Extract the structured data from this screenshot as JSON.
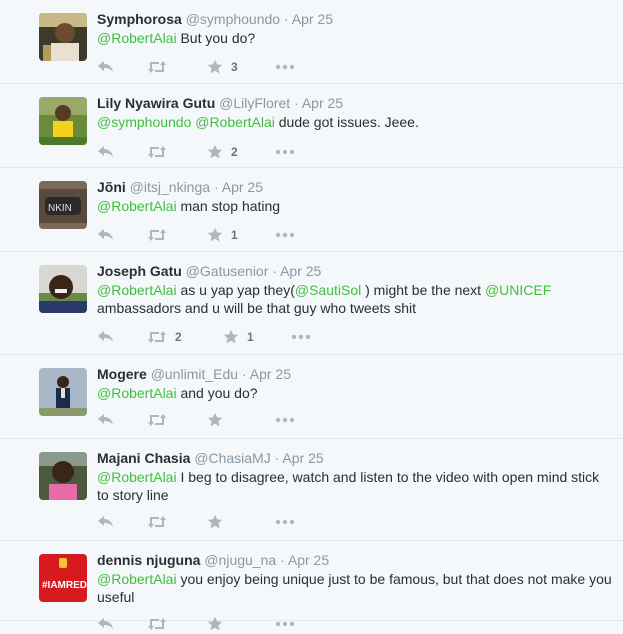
{
  "tweets": [
    {
      "name": "Symphorosa",
      "handle": "@symphoundo",
      "sep": "·",
      "time": "Apr 25",
      "text_parts": [
        {
          "t": "@RobertAlai",
          "mention": true
        },
        {
          "t": " But you do?"
        }
      ],
      "retweets": "",
      "favorites": "3"
    },
    {
      "name": "Lily Nyawira Gutu",
      "handle": "@LilyFloret",
      "sep": "·",
      "time": "Apr 25",
      "text_parts": [
        {
          "t": "@symphoundo",
          "mention": true
        },
        {
          "t": " "
        },
        {
          "t": "@RobertAlai",
          "mention": true
        },
        {
          "t": " dude got issues. Jeee."
        }
      ],
      "retweets": "",
      "favorites": "2"
    },
    {
      "name": "Jõni",
      "handle": "@itsj_nkinga",
      "sep": "·",
      "time": "Apr 25",
      "text_parts": [
        {
          "t": "@RobertAlai",
          "mention": true
        },
        {
          "t": " man stop hating"
        }
      ],
      "retweets": "",
      "favorites": "1"
    },
    {
      "name": "Joseph Gatu",
      "handle": "@Gatusenior",
      "sep": "·",
      "time": "Apr 25",
      "text_parts": [
        {
          "t": "@RobertAlai",
          "mention": true
        },
        {
          "t": " as u yap yap they("
        },
        {
          "t": "@SautiSol",
          "mention": true
        },
        {
          "t": " ) might be the next "
        },
        {
          "t": "@UNICEF",
          "mention": true
        },
        {
          "t": " ambassadors and u will be that guy who tweets shit"
        }
      ],
      "retweets": "2",
      "favorites": "1"
    },
    {
      "name": "Mogere",
      "handle": "@unlimit_Edu",
      "sep": "·",
      "time": "Apr 25",
      "text_parts": [
        {
          "t": "@RobertAlai",
          "mention": true
        },
        {
          "t": " and you do?"
        }
      ],
      "retweets": "",
      "favorites": ""
    },
    {
      "name": "Majani Chasia",
      "handle": "@ChasiaMJ",
      "sep": "·",
      "time": "Apr 25",
      "text_parts": [
        {
          "t": "@RobertAlai",
          "mention": true
        },
        {
          "t": " I beg to disagree, watch and listen to the video with open mind stick to story line"
        }
      ],
      "retweets": "",
      "favorites": ""
    },
    {
      "name": "dennis njuguna",
      "handle": "@njugu_na",
      "sep": "·",
      "time": "Apr 25",
      "text_parts": [
        {
          "t": "@RobertAlai",
          "mention": true
        },
        {
          "t": "  you enjoy being unique just to be famous, but that does not make you useful"
        }
      ],
      "retweets": "",
      "favorites": ""
    }
  ],
  "avatar_logo_text": "#IAMRED",
  "colors": {
    "mention": "#3fbf3f",
    "muted": "#8899a6",
    "icon": "#aab8c2",
    "border": "#e1e8ed",
    "bg": "#f5f8fa"
  }
}
